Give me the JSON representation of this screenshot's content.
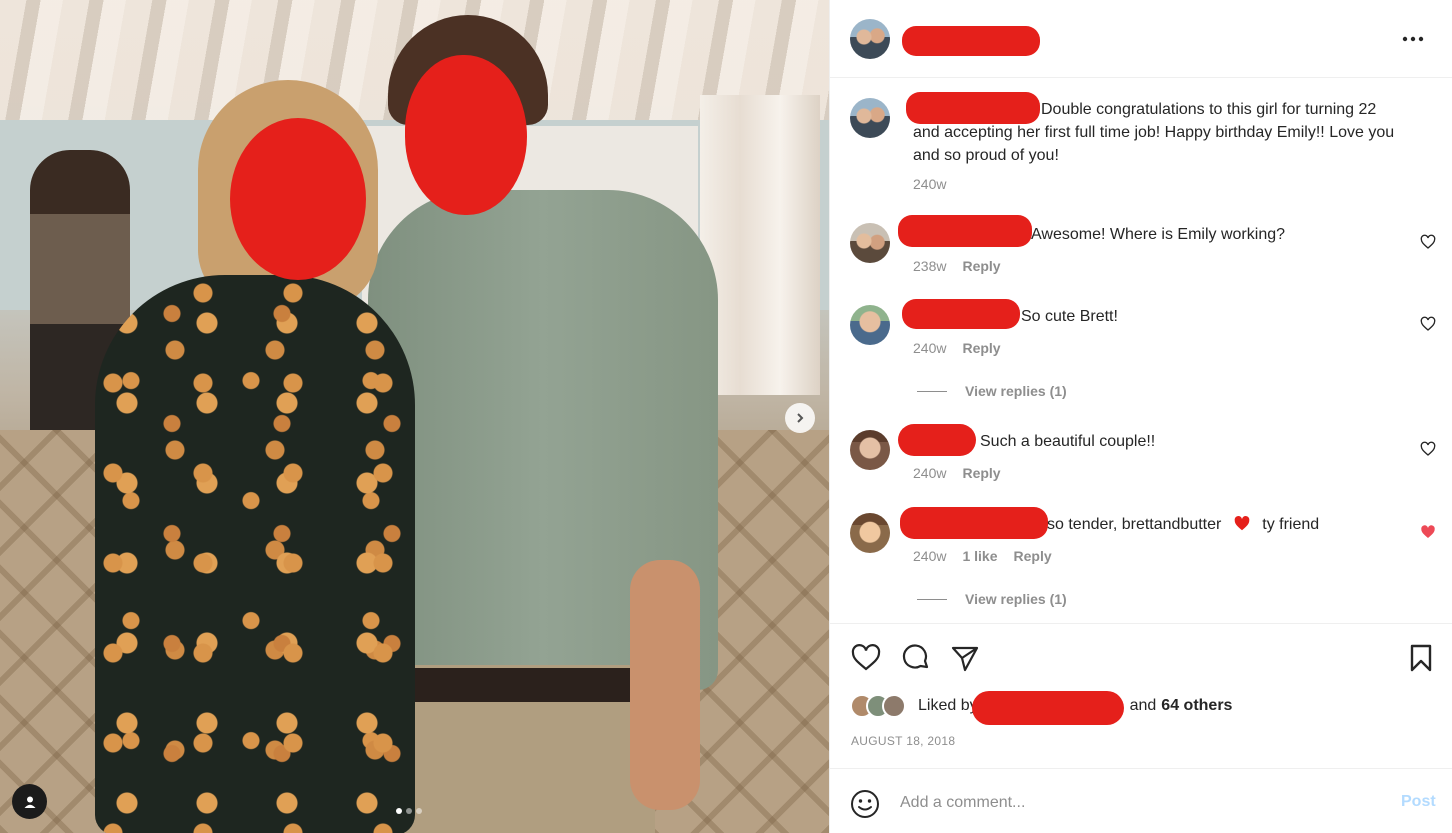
{
  "post": {
    "slide_count": 3,
    "active_slide": 1,
    "caption": {
      "text": "Double congratulations to this girl for turning 22 and accepting her first full time job! Happy birthday Emily!! Love you and so proud of you!",
      "time": "240w"
    }
  },
  "comments": [
    {
      "text": "Awesome! Where is Emily working?",
      "time": "238w",
      "likes": "",
      "reply_label": "Reply",
      "liked": false
    },
    {
      "text": "So cute Brett!",
      "time": "240w",
      "likes": "",
      "reply_label": "Reply",
      "liked": false,
      "view_replies": "View replies (1)"
    },
    {
      "text": "Such a beautiful couple!!",
      "time": "240w",
      "likes": "",
      "reply_label": "Reply",
      "liked": false
    },
    {
      "text_before": "so tender, brettandbutter",
      "text_after": "ty friend",
      "time": "240w",
      "likes": "1 like",
      "reply_label": "Reply",
      "liked": true,
      "view_replies": "View replies (1)"
    }
  ],
  "likes": {
    "prefix": "Liked by",
    "suffix": "and",
    "others": "64 others"
  },
  "date": "AUGUST 18, 2018",
  "add_comment": {
    "placeholder": "Add a comment...",
    "post_label": "Post"
  },
  "colors": {
    "redaction": "#e5201b",
    "like_red": "#ed4956",
    "post_disabled": "#b3dbff",
    "meta_gray": "#8e8e8e"
  }
}
